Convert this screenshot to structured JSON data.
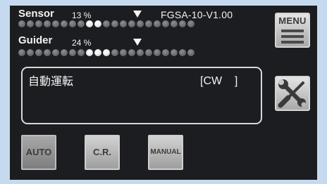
{
  "sensor": {
    "label": "Sensor",
    "percent": "13 %",
    "dots_total": 21,
    "dots_on": [
      8,
      9
    ]
  },
  "guider": {
    "label": "Guider",
    "percent": "24 %",
    "dots_total": 21,
    "dots_on": [
      8,
      9,
      10
    ]
  },
  "model": "FGSA-10-V1.00",
  "display": {
    "mode": "自動運転",
    "direction": "[CW    ]"
  },
  "side_buttons": {
    "menu_label": "MENU",
    "tools_icon": "wrench-screwdriver-icon"
  },
  "mode_buttons": {
    "auto": "AUTO",
    "cr": "C.R.",
    "manual": "MANUAL"
  },
  "colors": {
    "background": "#c5daee",
    "screen": "#1c1d20",
    "text": "#f2f2f2"
  }
}
